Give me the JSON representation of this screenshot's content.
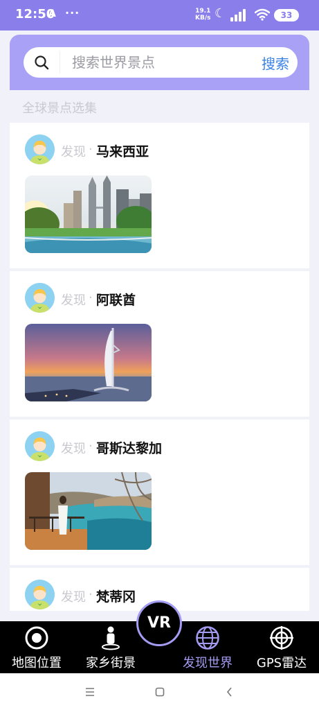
{
  "status_bar": {
    "time": "12:50",
    "notification_glyph": "A",
    "dots": "···",
    "speed_value": "19.1",
    "speed_unit": "KB/s",
    "battery": "33",
    "icons": [
      "moon-icon",
      "signal-icon",
      "wifi-icon",
      "battery-icon"
    ]
  },
  "search": {
    "placeholder": "搜索世界景点",
    "button_label": "搜索",
    "icon": "search-icon"
  },
  "section_title": "全球景点选集",
  "posts": [
    {
      "discover_label": "发现",
      "separator": "·",
      "place": "马来西亚",
      "photo": "kuala-lumpur-petronas-towers"
    },
    {
      "discover_label": "发现",
      "separator": "·",
      "place": "阿联酋",
      "photo": "dubai-burj-al-arab-sunset"
    },
    {
      "discover_label": "发现",
      "separator": "·",
      "place": "哥斯达黎加",
      "photo": "costa-rica-coast-balcony"
    },
    {
      "discover_label": "发现",
      "separator": "·",
      "place": "梵蒂冈",
      "photo": ""
    }
  ],
  "bottom_nav": {
    "items": [
      {
        "label": "地图位置",
        "icon": "location-target-icon"
      },
      {
        "label": "家乡街景",
        "icon": "street-view-person-icon"
      },
      {
        "label": "发现世界",
        "icon": "globe-icon",
        "active": true
      },
      {
        "label": "GPS雷达",
        "icon": "radar-crosshair-icon"
      }
    ],
    "vr_label": "VR"
  },
  "system_nav": {
    "icons": [
      "menu-icon",
      "home-icon",
      "back-icon"
    ]
  },
  "colors": {
    "accent": "#8a7fea",
    "accent_light": "#a49bf3",
    "search_button": "#3b82e6",
    "page_bg": "#f1f1f9"
  }
}
